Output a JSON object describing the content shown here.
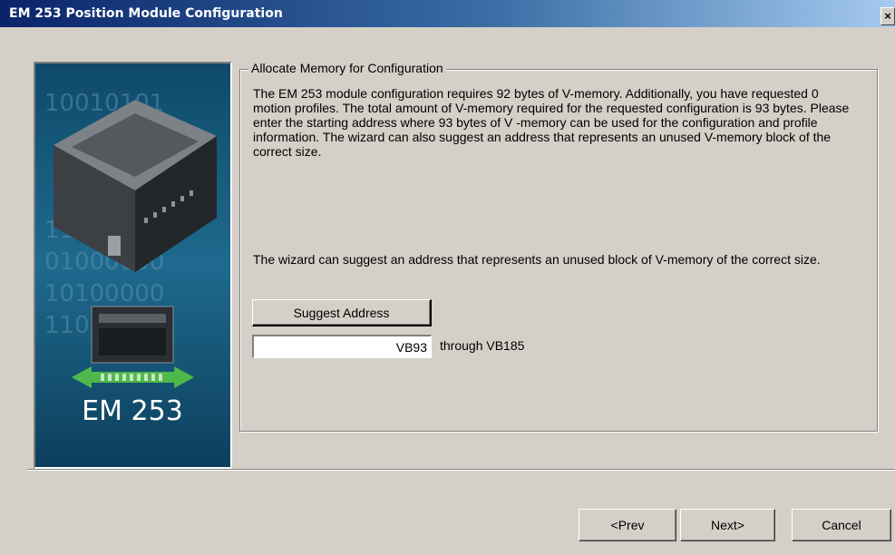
{
  "window": {
    "title": "EM 253 Position Module Configuration",
    "close_glyph": "×"
  },
  "banner": {
    "label": "EM 253",
    "binary_rows": [
      "10010101",
      "11010101",
      "01000000",
      "10100000",
      "11010000"
    ]
  },
  "group": {
    "legend": "Allocate Memory for Configuration",
    "description": "The EM 253 module configuration requires 92 bytes of V-memory.  Additionally, you have requested 0 motion profiles.  The total amount of V-memory required for the requested configuration is 93 bytes. Please enter the starting address where 93 bytes of V -memory can be used for the configuration and profile information. The wizard can also suggest an address that represents an unused V-memory block of the correct size.",
    "suggest_text": "The wizard can suggest an address that represents an unused block of V-memory of the correct size.",
    "suggest_button": "Suggest Address",
    "address_value": "VB93",
    "through_text": "through VB185"
  },
  "footer": {
    "prev": "<Prev",
    "next": "Next>",
    "cancel": "Cancel"
  },
  "colors": {
    "title_start": "#0a246a",
    "title_end": "#a6caf0",
    "banner_bg": "#1d5a7a",
    "banner_accent": "#4fb84a",
    "dialog_bg": "#d4d0c8"
  }
}
